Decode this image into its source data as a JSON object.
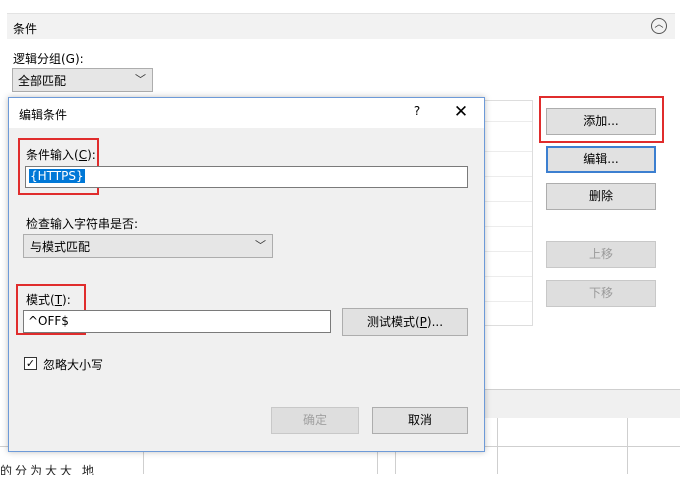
{
  "background": {
    "section_title": "条件",
    "collapse_icon": "chevron-up-icon",
    "group_label": "逻辑分组(G):",
    "group_value": "全部匹配",
    "buttons": {
      "add": "添加...",
      "edit": "编辑...",
      "delete": "删除",
      "move_up": "上移",
      "move_down": "下移"
    },
    "bottom_cut_text": "的分为大大 地"
  },
  "dialog": {
    "title": "编辑条件",
    "help": "?",
    "close": "✕",
    "condition_label": "条件输入(C):",
    "condition_value": "{HTTPS}",
    "check_label": "检查输入字符串是否:",
    "match_value": "与模式匹配",
    "pattern_label": "模式(T):",
    "pattern_value": "^OFF$",
    "test_button": "测试模式(P)...",
    "ignore_case_label": "忽略大小写",
    "ignore_case_checked": true,
    "ok_button": "确定",
    "cancel_button": "取消"
  },
  "colors": {
    "highlight": "#e02c2c",
    "selection": "#0078d7",
    "dialog_border": "#6d9ad8"
  }
}
